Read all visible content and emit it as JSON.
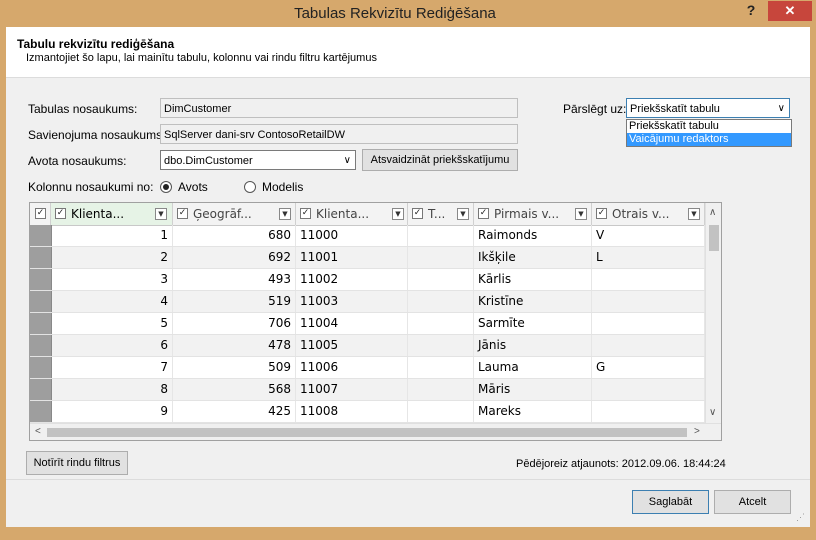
{
  "window": {
    "title": "Tabulas Rekvizītu Rediģēšana",
    "help_label": "?",
    "close_label": "✕"
  },
  "header": {
    "title": "Tabulu rekvizītu rediģēšana",
    "description": "Izmantojiet šo lapu, lai mainītu tabulu, kolonnu vai rindu filtru kartējumus"
  },
  "form": {
    "table_name_label": "Tabulas nosaukums:",
    "table_name_value": "DimCustomer",
    "connection_name_label": "Savienojuma nosaukums:",
    "connection_name_value": "SqlServer dani-srv ContosoRetailDW",
    "source_name_label": "Avota nosaukums:",
    "source_name_value": "dbo.DimCustomer",
    "refresh_preview_label": "Atsvaidzināt priekšskatījumu",
    "column_names_label": "Kolonnu nosaukumi no:",
    "radio_source_label": "Avots",
    "radio_model_label": "Modelis",
    "switch_label": "Pārslēgt uz:",
    "switch_value": "Priekšskatīt tabulu",
    "switch_options": [
      "Priekšskatīt tabulu",
      "Vaicājumu redaktors"
    ]
  },
  "grid": {
    "columns": [
      "Klienta...",
      "Ģeogrāf...",
      "Klienta...",
      "T...",
      "Pirmais v...",
      "Otrais v..."
    ],
    "rows": [
      {
        "c1": "1",
        "c2": "680",
        "c3": "11000",
        "c4": "",
        "c5": "Raimonds",
        "c6": "V"
      },
      {
        "c1": "2",
        "c2": "692",
        "c3": "11001",
        "c4": "",
        "c5": "Ikšķile",
        "c6": "L"
      },
      {
        "c1": "3",
        "c2": "493",
        "c3": "11002",
        "c4": "",
        "c5": "Kārlis",
        "c6": ""
      },
      {
        "c1": "4",
        "c2": "519",
        "c3": "11003",
        "c4": "",
        "c5": "Kristīne",
        "c6": ""
      },
      {
        "c1": "5",
        "c2": "706",
        "c3": "11004",
        "c4": "",
        "c5": "Sarmīte",
        "c6": ""
      },
      {
        "c1": "6",
        "c2": "478",
        "c3": "11005",
        "c4": "",
        "c5": "Jānis",
        "c6": ""
      },
      {
        "c1": "7",
        "c2": "509",
        "c3": "11006",
        "c4": "",
        "c5": "Lauma",
        "c6": "G"
      },
      {
        "c1": "8",
        "c2": "568",
        "c3": "11007",
        "c4": "",
        "c5": "Māris",
        "c6": ""
      },
      {
        "c1": "9",
        "c2": "425",
        "c3": "11008",
        "c4": "",
        "c5": "Mareks",
        "c6": ""
      }
    ]
  },
  "bottom": {
    "clear_filters_label": "Notīrīt rindu filtrus",
    "last_updated": "Pēdējoreiz atjaunots: 2012.09.06. 18:44:24"
  },
  "footer": {
    "save_label": "Saglabāt",
    "cancel_label": "Atcelt"
  },
  "colors": {
    "frame": "#d6a86c",
    "close": "#c7463c",
    "selection": "#3399ff"
  }
}
